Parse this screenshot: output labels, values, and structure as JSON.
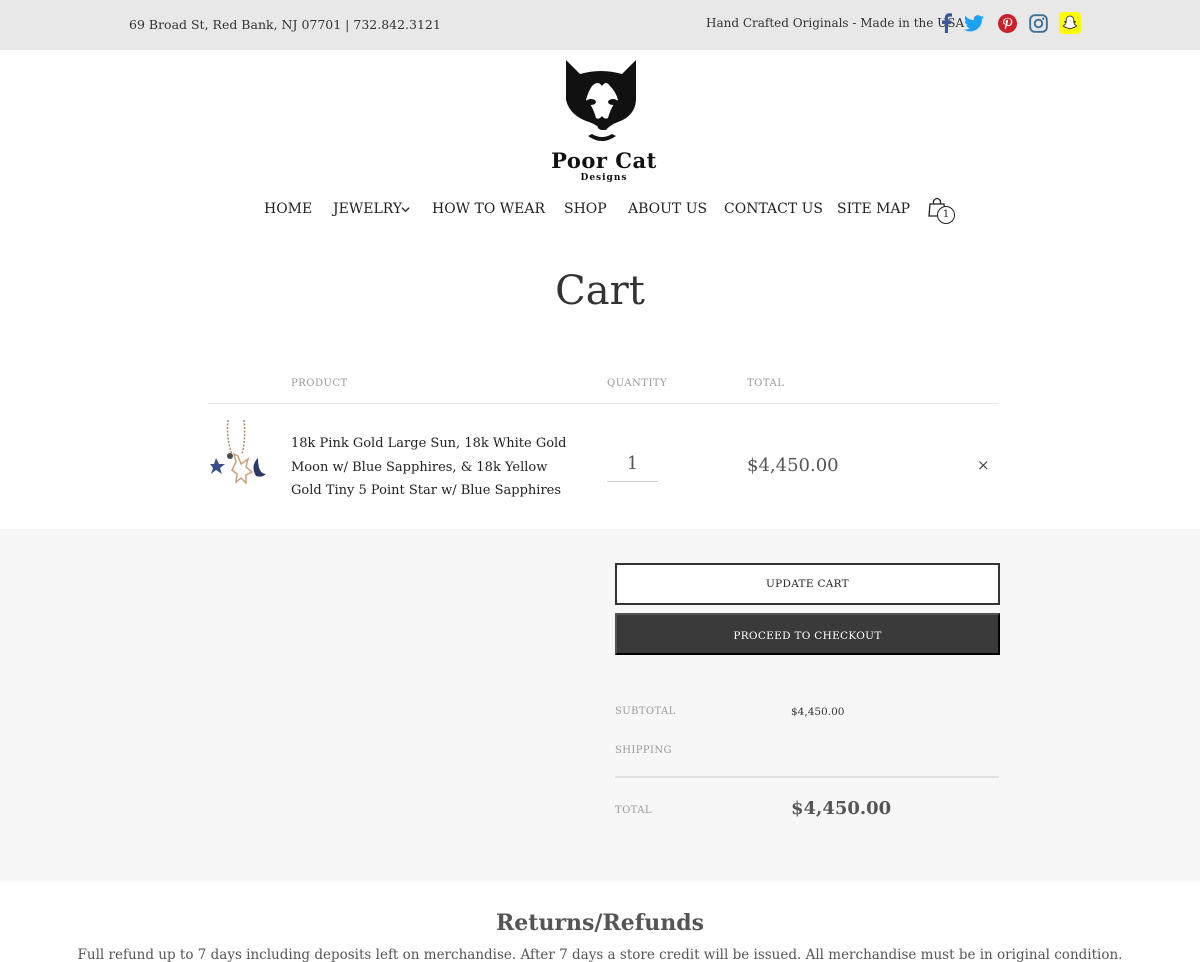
{
  "topbar": {
    "address": "69 Broad St, Red Bank, NJ 07701 | 732.842.3121",
    "tagline": "Hand Crafted Originals - Made in the USA",
    "social": [
      {
        "icon": "facebook-icon",
        "color": "#3b5998"
      },
      {
        "icon": "twitter-icon",
        "color": "#1da1f2"
      },
      {
        "icon": "pinterest-icon",
        "color": "#cb2027"
      },
      {
        "icon": "instagram-icon",
        "color": "#3f729b"
      },
      {
        "icon": "snapchat-icon",
        "color": "#fffc00"
      }
    ]
  },
  "logo": {
    "brand": "Poor Cat",
    "sub": "Designs"
  },
  "nav": {
    "home": "HOME",
    "jewelry": "JEWELRY",
    "how_to_wear": "HOW TO WEAR",
    "shop": "SHOP",
    "about": "ABOUT US",
    "contact": "CONTACT US",
    "sitemap": "SITE MAP",
    "cart_count": "1"
  },
  "page": {
    "title": "Cart"
  },
  "cart": {
    "headers": {
      "product": "PRODUCT",
      "quantity": "QUANTITY",
      "total": "TOTAL"
    },
    "items": [
      {
        "name": "18k Pink Gold Large Sun, 18k White Gold Moon w/ Blue Sapphires, & 18k Yellow Gold Tiny 5 Point Star w/ Blue Sapphires",
        "quantity": "1",
        "total": "$4,450.00",
        "remove": "×"
      }
    ]
  },
  "totals": {
    "update_label": "UPDATE CART",
    "checkout_label": "PROCEED TO CHECKOUT",
    "subtotal_label": "SUBTOTAL",
    "subtotal_value": "$4,450.00",
    "shipping_label": "SHIPPING",
    "total_label": "TOTAL",
    "total_value": "$4,450.00"
  },
  "returns": {
    "title": "Returns/Refunds",
    "text": "Full refund up to 7 days including deposits left on merchandise. After 7 days a store credit will be issued. All merchandise must be in original condition."
  },
  "colors": {
    "topbar_bg": "#e8e8e8",
    "panel_bg": "#f7f7f7",
    "checkout_bg": "#3a3a3a"
  }
}
